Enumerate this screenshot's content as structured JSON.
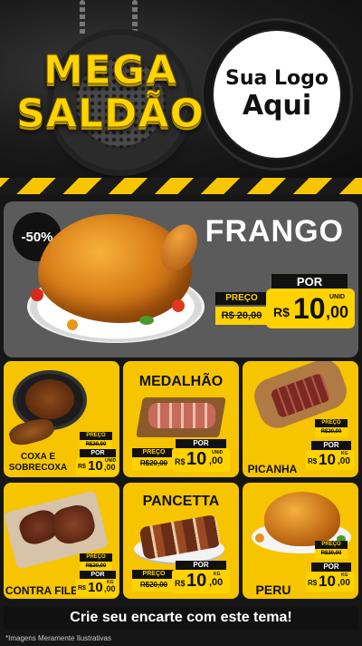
{
  "header": {
    "title_line1": "MEGA",
    "title_line2": "SALDÃO",
    "logo_line1": "Sua Logo",
    "logo_line2": "Aqui"
  },
  "feature": {
    "discount": "-50%",
    "name": "FRANGO",
    "por": "POR",
    "preco": "PREÇO",
    "old_price": "R$ 20,00",
    "currency": "R$",
    "price_int": "10",
    "price_dec": ",00",
    "unit": "UNID"
  },
  "cards": [
    {
      "name_l1": "COXA E",
      "name_l2": "SOBRECOXA",
      "preco": "PREÇO",
      "old_price": "R$20,00",
      "por": "POR",
      "currency": "R$",
      "price_int": "10",
      "price_dec": ",00",
      "unit": "UNID"
    },
    {
      "name_l1": "MEDALHÃO",
      "preco": "PREÇO",
      "old_price": "R$20,00",
      "por": "POR",
      "currency": "R$",
      "price_int": "10",
      "price_dec": ",00",
      "unit": "UNID"
    },
    {
      "name_l1": "PICANHA",
      "preco": "PREÇO",
      "old_price": "R$20,00",
      "por": "POR",
      "currency": "R$",
      "price_int": "10",
      "price_dec": ",00",
      "unit": "KG"
    },
    {
      "name_l1": "CONTRA FILE",
      "preco": "PREÇO",
      "old_price": "R$20,00",
      "por": "POR",
      "currency": "R$",
      "price_int": "10",
      "price_dec": ",00",
      "unit": "KG"
    },
    {
      "name_l1": "PANCETTA",
      "preco": "PREÇO",
      "old_price": "R$20,00",
      "por": "POR",
      "currency": "R$",
      "price_int": "10",
      "price_dec": ",00",
      "unit": "KG"
    },
    {
      "name_l1": "PERU",
      "preco": "PREÇO",
      "old_price": "R$20,00",
      "por": "POR",
      "currency": "R$",
      "price_int": "10",
      "price_dec": ",00",
      "unit": "KG"
    }
  ],
  "footer": {
    "cta": "Crie seu encarte com este tema!",
    "disclaimer": "*Imagens Meramente Ilustrativas"
  },
  "colors": {
    "accent": "#ffd200",
    "dark": "#111111",
    "feature_bg": "#5b5b5b"
  }
}
